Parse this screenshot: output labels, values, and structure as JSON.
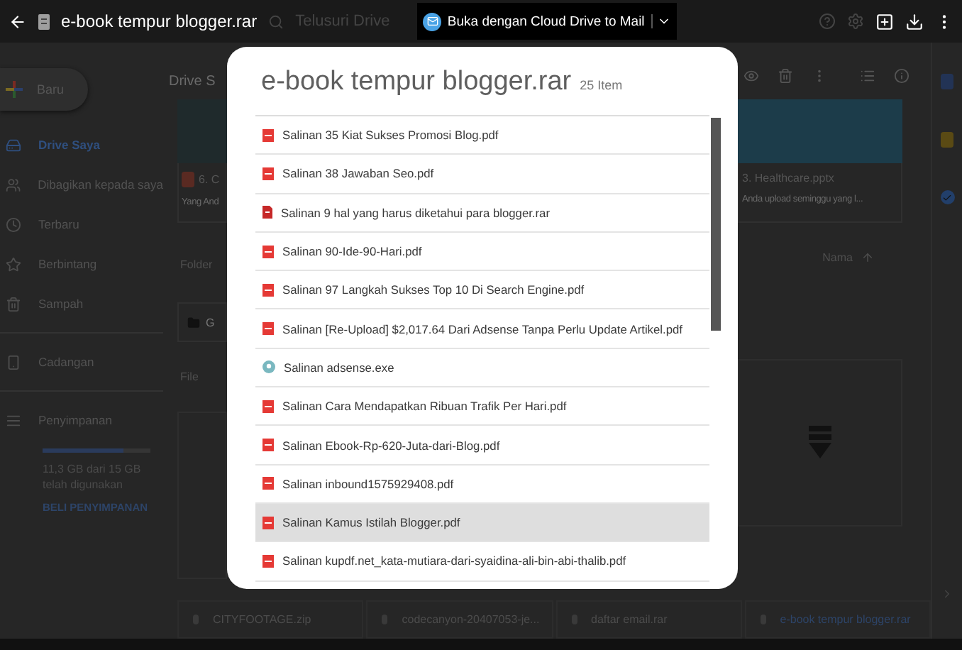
{
  "topbar": {
    "file_title": "e-book tempur blogger.rar",
    "search_placeholder": "Telusuri Drive",
    "open_with": "Buka dengan Cloud Drive to Mail"
  },
  "sidebar": {
    "new_button": "Baru",
    "items": [
      {
        "kind": "drive",
        "label": "Drive Saya",
        "selected": true
      },
      {
        "kind": "shared",
        "label": "Dibagikan kepada saya",
        "selected": false
      },
      {
        "kind": "recent",
        "label": "Terbaru",
        "selected": false
      },
      {
        "kind": "starred",
        "label": "Berbintang",
        "selected": false
      },
      {
        "kind": "trash",
        "label": "Sampah",
        "selected": false
      },
      {
        "kind": "backup",
        "label": "Cadangan",
        "selected": false
      }
    ],
    "storage": {
      "label": "Penyimpanan",
      "level": 0.75,
      "usage": "11,3 GB dari 15 GB telah digunakan",
      "buy": "BELI PENYIMPANAN"
    }
  },
  "main": {
    "heading": "Drive S",
    "left_card": {
      "name": "6. C",
      "sub": "Yang And"
    },
    "right_card": {
      "name": "3. Healthcare.pptx",
      "sub": "Anda upload seminggu yang l..."
    },
    "folder_label": "Folder",
    "folder_name": "G",
    "file_label": "File",
    "sort_label": "Nama",
    "bottom_files": [
      "CITYFOOTAGE.zip",
      "codecanyon-20407053-je...",
      "daftar email.rar",
      "e-book tempur blogger.rar"
    ]
  },
  "dialog": {
    "title": "e-book tempur blogger.rar",
    "count": "25 Item",
    "items": [
      {
        "kind": "pdf",
        "name": "Salinan 35 Kiat Sukses Promosi Blog.pdf",
        "selected": false
      },
      {
        "kind": "pdf",
        "name": "Salinan 38 Jawaban Seo.pdf",
        "selected": false
      },
      {
        "kind": "rar",
        "name": "Salinan 9 hal yang harus diketahui para blogger.rar",
        "selected": false
      },
      {
        "kind": "pdf",
        "name": "Salinan 90-Ide-90-Hari.pdf",
        "selected": false
      },
      {
        "kind": "pdf",
        "name": "Salinan 97 Langkah Sukses Top 10 Di Search Engine.pdf",
        "selected": false
      },
      {
        "kind": "pdf",
        "name": "Salinan [Re-Upload] $2,017.64 Dari Adsense Tanpa Perlu Update Artikel.pdf",
        "selected": false
      },
      {
        "kind": "exe",
        "name": "Salinan adsense.exe",
        "selected": false
      },
      {
        "kind": "pdf",
        "name": "Salinan Cara Mendapatkan Ribuan Trafik Per Hari.pdf",
        "selected": false
      },
      {
        "kind": "pdf",
        "name": "Salinan Ebook-Rp-620-Juta-dari-Blog.pdf",
        "selected": false
      },
      {
        "kind": "pdf",
        "name": "Salinan inbound1575929408.pdf",
        "selected": false
      },
      {
        "kind": "pdf",
        "name": "Salinan Kamus Istilah Blogger.pdf",
        "selected": true
      },
      {
        "kind": "pdf",
        "name": "Salinan kupdf.net_kata-mutiara-dari-syaidina-ali-bin-abi-thalib.pdf",
        "selected": false
      }
    ]
  }
}
